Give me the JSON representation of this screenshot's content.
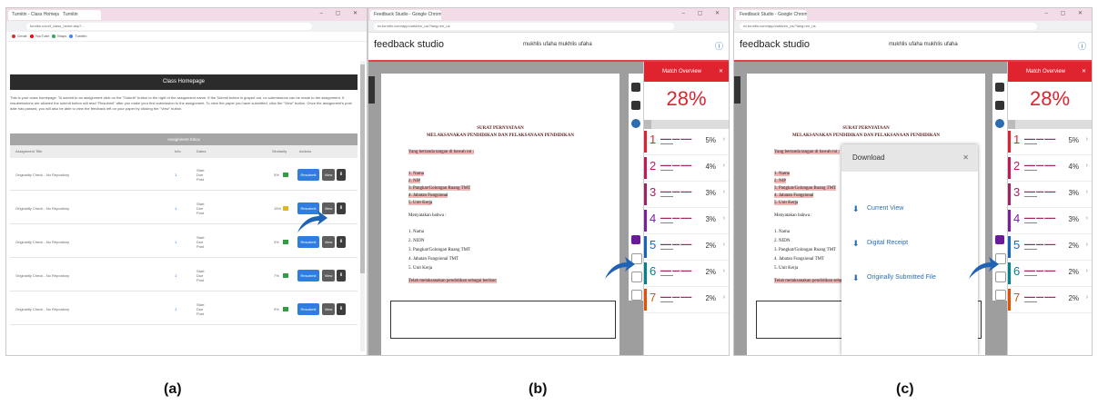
{
  "captions": {
    "a": "(a)",
    "b": "(b)",
    "c": "(c)"
  },
  "panel_a": {
    "tabs": [
      "Turnitin - Class Homepage",
      "Turnitin"
    ],
    "url": "turnitin.com/t_class_home.asp?...",
    "bookmarks": [
      "Gmail",
      "YouTube",
      "Maps",
      "Turnitin"
    ],
    "homepage_button": "Class Homepage",
    "info_text": "This is your class homepage. To submit to an assignment click on the \"Submit\" button to the right of the assignment name. If the Submit button is grayed out, no submissions can be made to the assignment. If resubmissions are allowed the submit button will read \"Resubmit\" after you make your first submission to the assignment. To view the paper you have submitted, click the \"View\" button. Once the assignment's post date has passed, you will also be able to view the feedback left on your paper by clicking the \"View\" button.",
    "table_header": "Assignment Inbox",
    "columns": [
      "Assignment Title",
      "Info",
      "Dates",
      "Similarity",
      "Actions"
    ],
    "rows": [
      {
        "title": "Originality Check - No Repository",
        "id": "1",
        "dates": [
          "Start",
          "Due",
          "Post"
        ],
        "pct": "5%",
        "sim_color": "#2ea043"
      },
      {
        "title": "Originality Check - No Repository",
        "id": "1",
        "dates": [
          "Start",
          "Due",
          "Post"
        ],
        "pct": "15%",
        "sim_color": "#e3b81b"
      },
      {
        "title": "Originality Check - No Repository",
        "id": "1",
        "dates": [
          "Start",
          "Due",
          "Post"
        ],
        "pct": "3%",
        "sim_color": "#2ea043"
      },
      {
        "title": "Originality Check - No Repository",
        "id": "1",
        "dates": [
          "Start",
          "Due",
          "Post"
        ],
        "pct": "7%",
        "sim_color": "#2ea043"
      },
      {
        "title": "Originality Check - No Repository",
        "id": "1",
        "dates": [
          "Start",
          "Due",
          "Post"
        ],
        "pct": "9%",
        "sim_color": "#2ea043"
      }
    ],
    "btn_resubmit": "Resubmit",
    "btn_view": "View",
    "btn_download": "⬇"
  },
  "feedback": {
    "tab_title": "Feedback Studio - Google Chrome",
    "url": "ev.turnitin.com/app/carta/en_us/?lang=en_us",
    "logo": "feedback studio",
    "user": "mukhlis ufaha mukhlis ufaha",
    "match_overview": "Match Overview",
    "match_percent": "28%",
    "doc_title_1": "SURAT PERNYATAAN",
    "doc_title_2": "MELAKSANAKAN PENDIDIKAN DAN PELAKSANAAN PENDIDIKAN",
    "doc_lines": [
      "Yang bertanda tangan di bawah ini :",
      "1. Nama",
      "2. NIP",
      "3. Pangkat/Golongan Ruang TMT",
      "4. Jabatan Fungsional",
      "5. Unit Kerja",
      "Menyatakan bahwa :",
      "1. Nama",
      "2. NIDN",
      "3. Pangkat/Golongan Ruang TMT",
      "4. Jabatan Fungsional TMT",
      "5. Unit Kerja",
      "Telah melaksanakan pendidikan sebagai berikut:"
    ],
    "match_rows": [
      {
        "num": "1",
        "pct": "5%",
        "color": "#e0242f"
      },
      {
        "num": "2",
        "pct": "4%",
        "color": "#c2185b"
      },
      {
        "num": "3",
        "pct": "3%",
        "color": "#a0245f"
      },
      {
        "num": "4",
        "pct": "3%",
        "color": "#7b1fa2"
      },
      {
        "num": "5",
        "pct": "2%",
        "color": "#1565c0"
      },
      {
        "num": "6",
        "pct": "2%",
        "color": "#00838f"
      },
      {
        "num": "7",
        "pct": "2%",
        "color": "#e65100"
      }
    ],
    "download_dialog": {
      "title": "Download",
      "items": [
        "Current View",
        "Digital Receipt",
        "Originally Submitted File"
      ]
    }
  }
}
